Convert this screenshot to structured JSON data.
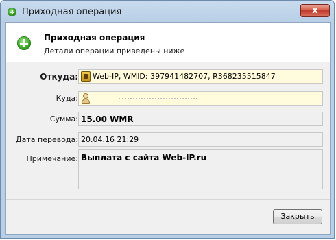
{
  "window": {
    "title": "Приходная операция",
    "close_label": "x"
  },
  "header": {
    "title": "Приходная операция",
    "subtitle": "Детали операции приведены ниже"
  },
  "form": {
    "from": {
      "label": "Откуда:",
      "value": "Web-IP, WMID: 397941482707, R368235515847",
      "icon": "purse-icon"
    },
    "to": {
      "label": "Куда:",
      "value": "",
      "icon": "user-icon"
    },
    "amount": {
      "label": "Сумма:",
      "value": "15.00 WMR"
    },
    "date": {
      "label": "Дата перевода:",
      "value": "20.04.16 21:29"
    },
    "note": {
      "label": "Примечание:",
      "value": "Выплата с сайта Web-IP.ru"
    }
  },
  "footer": {
    "close_button": "Закрыть"
  },
  "colors": {
    "field_highlight": "#fffbdc",
    "accent_green": "#38a623",
    "close_red": "#c0392b"
  }
}
